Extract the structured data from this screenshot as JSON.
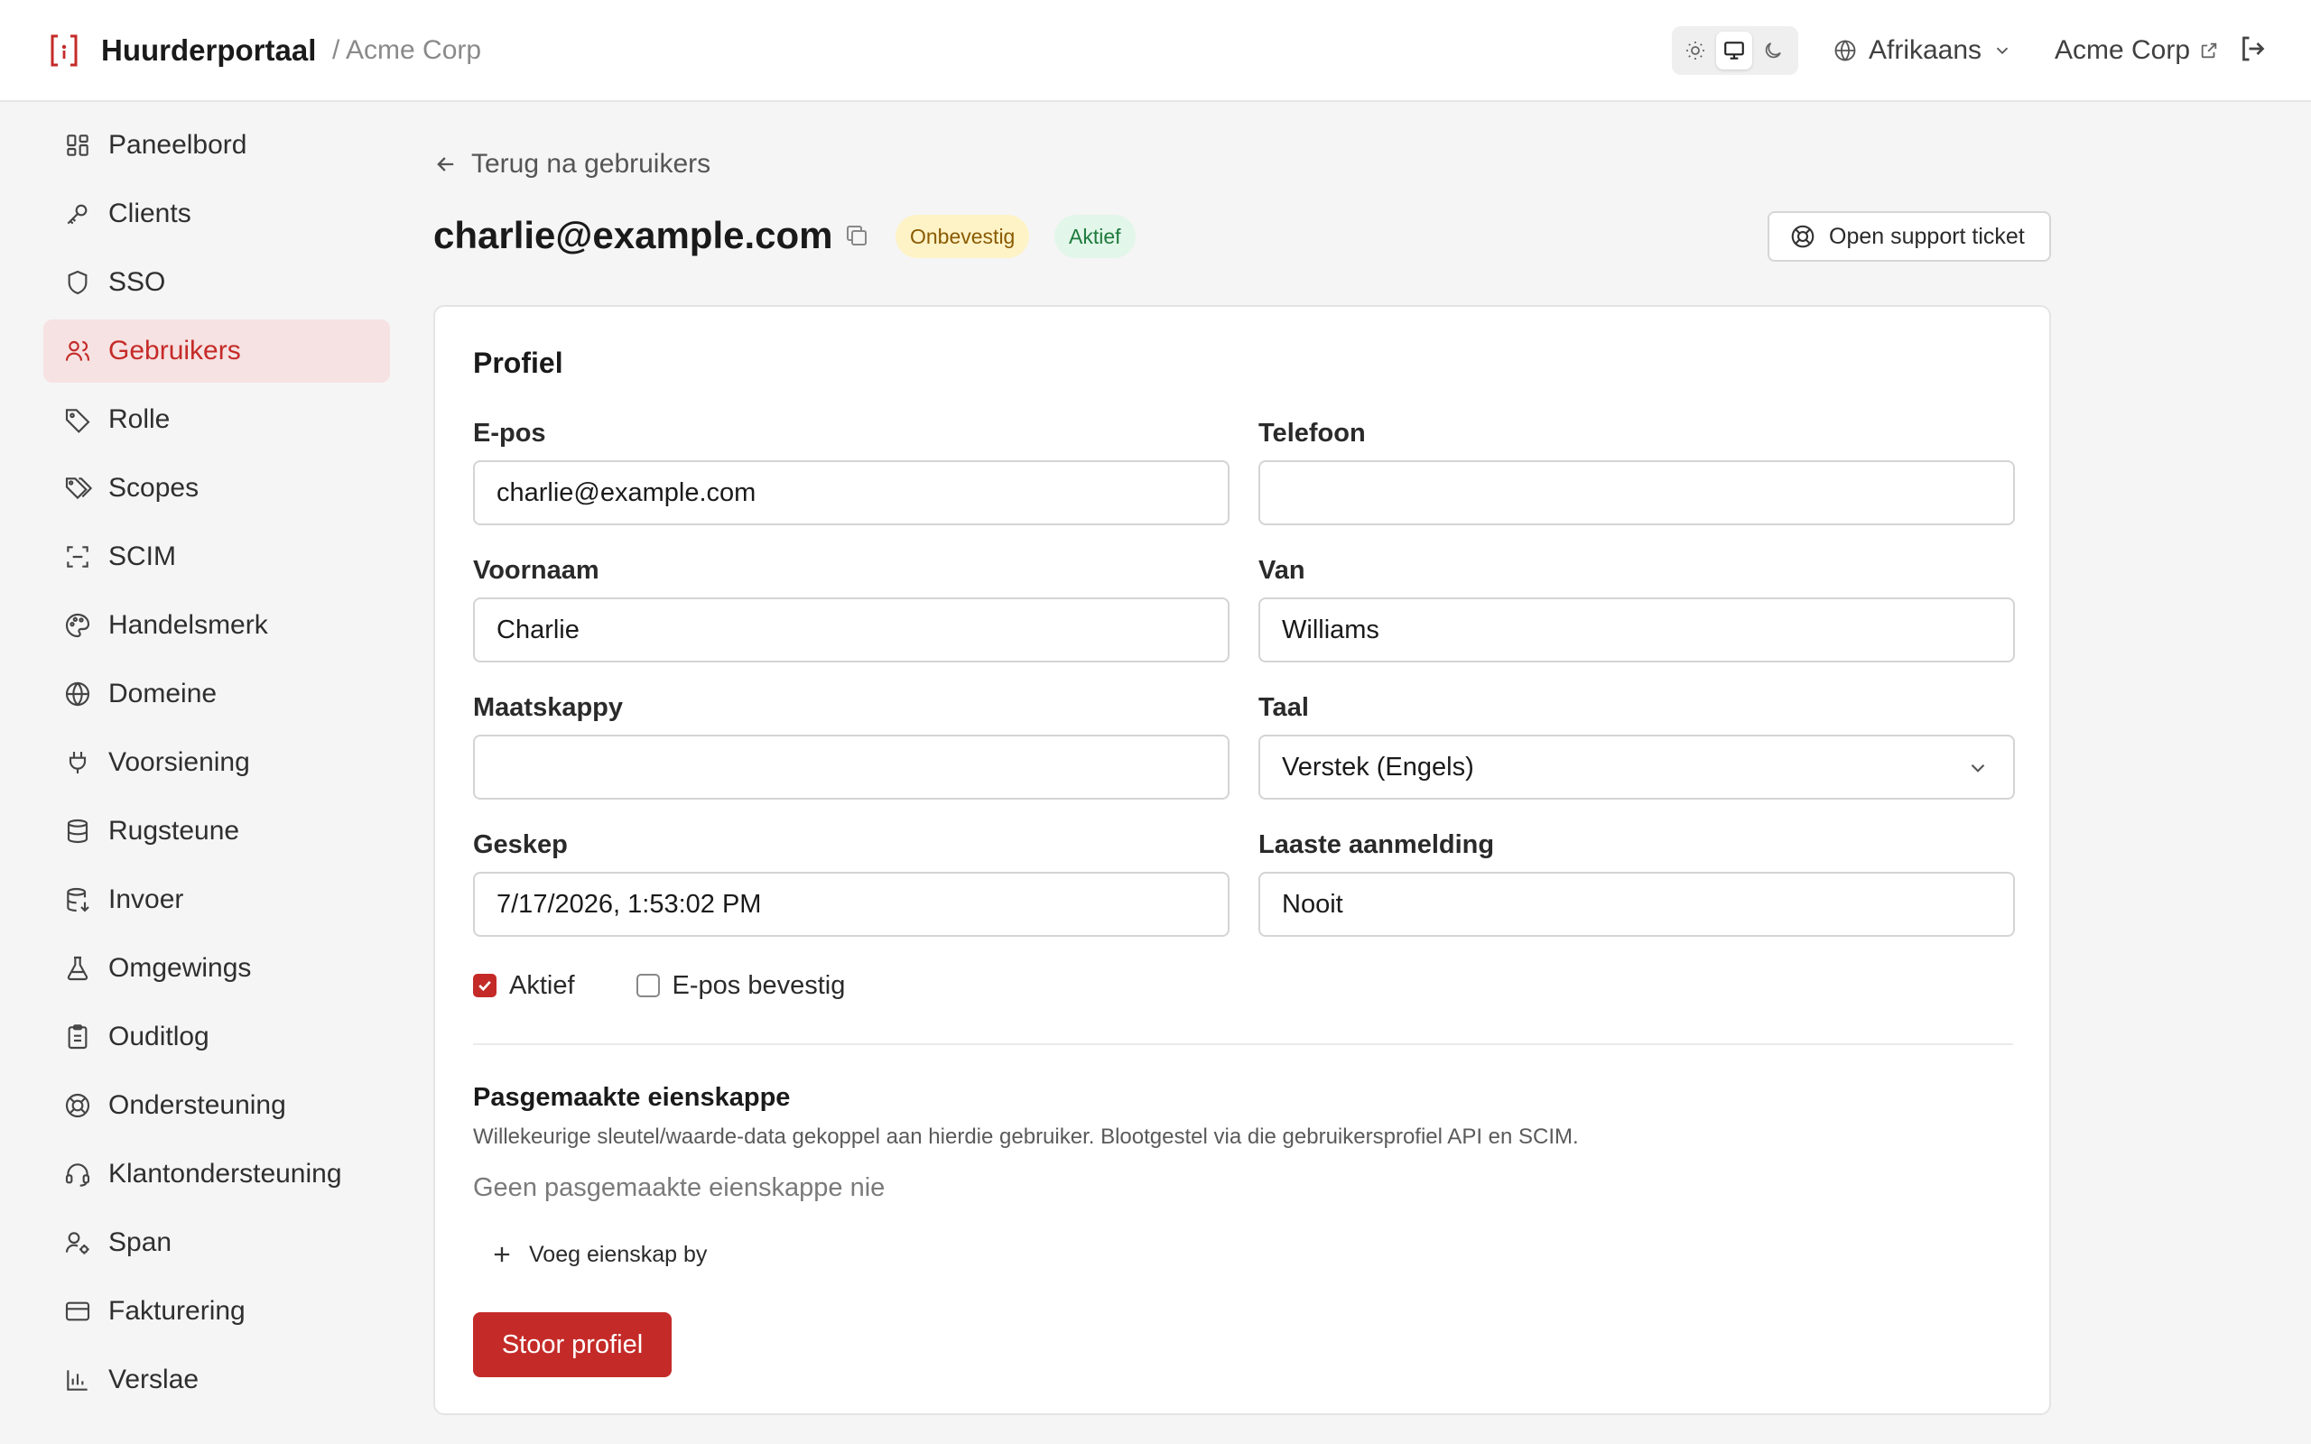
{
  "header": {
    "app_name": "Huurderportaal",
    "org_breadcrumb": "/ Acme Corp",
    "language": "Afrikaans",
    "org_link": "Acme Corp"
  },
  "sidebar": {
    "items": [
      {
        "label": "Paneelbord",
        "icon": "dashboard-icon"
      },
      {
        "label": "Clients",
        "icon": "key-icon"
      },
      {
        "label": "SSO",
        "icon": "shield-icon"
      },
      {
        "label": "Gebruikers",
        "icon": "users-icon",
        "active": true
      },
      {
        "label": "Rolle",
        "icon": "tag-icon"
      },
      {
        "label": "Scopes",
        "icon": "tags-icon"
      },
      {
        "label": "SCIM",
        "icon": "scan-icon"
      },
      {
        "label": "Handelsmerk",
        "icon": "palette-icon"
      },
      {
        "label": "Domeine",
        "icon": "globe-icon"
      },
      {
        "label": "Voorsiening",
        "icon": "plug-icon"
      },
      {
        "label": "Rugsteune",
        "icon": "database-icon"
      },
      {
        "label": "Invoer",
        "icon": "database-import-icon"
      },
      {
        "label": "Omgewings",
        "icon": "flask-icon"
      },
      {
        "label": "Ouditlog",
        "icon": "clipboard-icon"
      },
      {
        "label": "Ondersteuning",
        "icon": "lifebuoy-icon"
      },
      {
        "label": "Klantondersteuning",
        "icon": "headset-icon"
      },
      {
        "label": "Span",
        "icon": "user-cog-icon"
      },
      {
        "label": "Fakturering",
        "icon": "credit-card-icon"
      },
      {
        "label": "Verslae",
        "icon": "bar-chart-icon"
      }
    ]
  },
  "page": {
    "back_label": "Terug na gebruikers",
    "title": "charlie@example.com",
    "badge_unverified": "Onbevestig",
    "badge_active": "Aktief",
    "support_button": "Open support ticket"
  },
  "profile": {
    "title": "Profiel",
    "email_label": "E-pos",
    "email_value": "charlie@example.com",
    "phone_label": "Telefoon",
    "phone_value": "",
    "first_name_label": "Voornaam",
    "first_name_value": "Charlie",
    "last_name_label": "Van",
    "last_name_value": "Williams",
    "company_label": "Maatskappy",
    "company_value": "",
    "language_label": "Taal",
    "language_value": "Verstek (Engels)",
    "created_label": "Geskep",
    "created_value": "7/17/2026, 1:53:02 PM",
    "last_login_label": "Laaste aanmelding",
    "last_login_value": "Nooit",
    "active_checkbox_label": "Aktief",
    "active_checked": true,
    "email_verified_label": "E-pos bevestig",
    "email_verified_checked": false
  },
  "custom_properties": {
    "title": "Pasgemaakte eienskappe",
    "description": "Willekeurige sleutel/waarde-data gekoppel aan hierdie gebruiker. Blootgestel via die gebruikersprofiel API en SCIM.",
    "empty_text": "Geen pasgemaakte eienskappe nie",
    "add_label": "Voeg eienskap by"
  },
  "actions": {
    "save_label": "Stoor profiel"
  },
  "colors": {
    "accent": "#c42b28",
    "active_nav_bg": "#f6e2e2"
  }
}
